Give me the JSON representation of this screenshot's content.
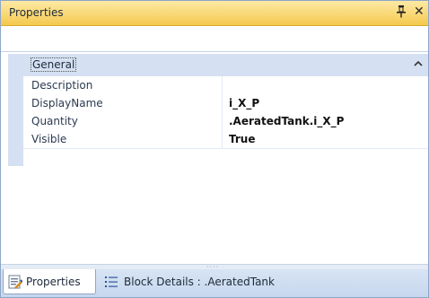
{
  "window": {
    "title": "Properties"
  },
  "grid": {
    "category": "General",
    "properties": [
      {
        "name": "Description",
        "value": ""
      },
      {
        "name": "DisplayName",
        "value": "i_X_P"
      },
      {
        "name": "Quantity",
        "value": ".AeratedTank.i_X_P"
      },
      {
        "name": "Visible",
        "value": "True"
      }
    ]
  },
  "tabs": [
    {
      "label": "Properties",
      "icon": "properties-icon",
      "active": true
    },
    {
      "label": "Block Details : .AeratedTank",
      "icon": "list-icon",
      "active": false
    }
  ],
  "colors": {
    "title_bar": "#f9d876",
    "category_band": "#d5e1f2",
    "tab_bar": "#c7d7ee"
  }
}
